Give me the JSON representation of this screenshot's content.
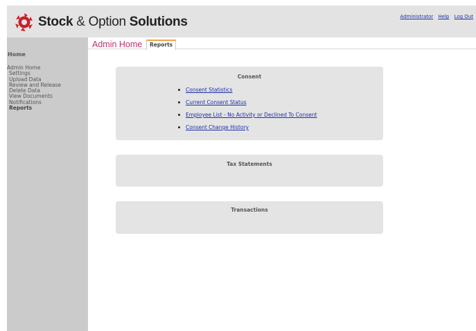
{
  "header": {
    "brand_word1": "Stock",
    "brand_amp": " & ",
    "brand_word2": "Option",
    "brand_word3": " Solutions",
    "links": [
      "Administrator",
      "Help",
      "Log Out"
    ]
  },
  "sidebar": {
    "home": "Home",
    "admin_home": "Admin Home",
    "items": [
      "Settings",
      "Upload Data",
      "Review and Release",
      "Delete Data",
      "View Documents",
      "Notifications",
      "Reports"
    ],
    "active_item": "Reports"
  },
  "tabs": {
    "admin_home": "Admin Home",
    "reports": "Reports"
  },
  "panels": {
    "consent": {
      "title": "Consent",
      "links": [
        "Consent Statistics",
        "Current Consent Status",
        "Employee List - No Activity or Declined To Consent",
        "Consent Change History"
      ]
    },
    "tax": {
      "title": "Tax Statements"
    },
    "transactions": {
      "title": "Transactions"
    }
  },
  "colors": {
    "link": "#1b2ea8",
    "tab_admin": "#b83270",
    "tab_accent": "#f0a24a",
    "logo_red": "#c8202a"
  }
}
